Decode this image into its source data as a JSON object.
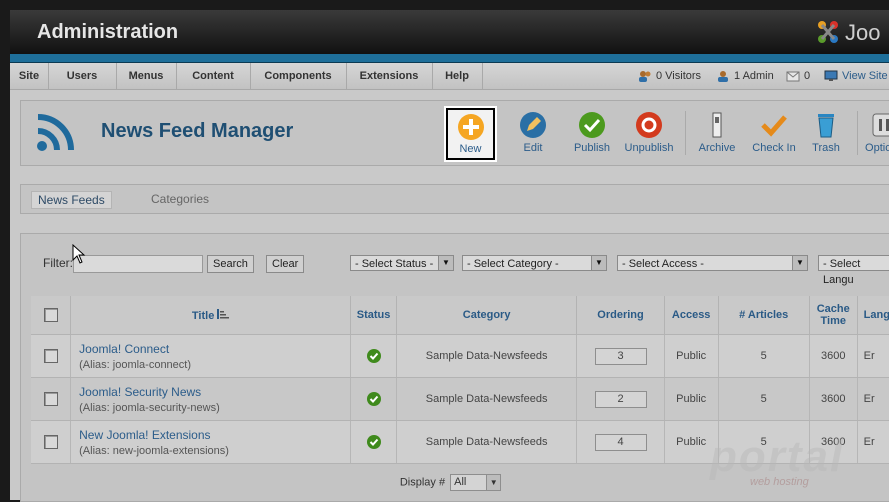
{
  "header": {
    "title": "Administration",
    "logo_text": "Joo"
  },
  "menu": {
    "items": [
      "Site",
      "Users",
      "Menus",
      "Content",
      "Components",
      "Extensions",
      "Help"
    ],
    "status": {
      "visitors": "0 Visitors",
      "admins": "1 Admin",
      "messages": "0",
      "view_site": "View Site"
    }
  },
  "page": {
    "title": "News Feed Manager",
    "icon": "rss-icon"
  },
  "toolbar": [
    {
      "label": "New",
      "icon": "plus-circle-icon",
      "highlighted": true
    },
    {
      "label": "Edit",
      "icon": "pencil-icon"
    },
    {
      "label": "Publish",
      "icon": "checkmark-icon"
    },
    {
      "label": "Unpublish",
      "icon": "stop-circle-icon"
    },
    {
      "label": "Archive",
      "icon": "archive-icon"
    },
    {
      "label": "Check In",
      "icon": "check-icon"
    },
    {
      "label": "Trash",
      "icon": "trash-icon"
    },
    {
      "label": "Options",
      "icon": "options-icon"
    }
  ],
  "subtabs": {
    "active": "News Feeds",
    "other": "Categories"
  },
  "filter": {
    "label": "Filter:",
    "value": "",
    "search_label": "Search",
    "clear_label": "Clear",
    "status_select": "- Select Status -",
    "category_select": "- Select Category -",
    "access_select": "- Select Access -",
    "language_select": "- Select Langu"
  },
  "table": {
    "columns": [
      "Title",
      "Status",
      "Category",
      "Ordering",
      "Access",
      "# Articles",
      "Cache Time",
      "Lang"
    ],
    "rows": [
      {
        "title": "Joomla! Connect",
        "alias": "(Alias: joomla-connect)",
        "category": "Sample Data-Newsfeeds",
        "ordering": "3",
        "access": "Public",
        "articles": "5",
        "cache": "3600",
        "lang": "Er"
      },
      {
        "title": "Joomla! Security News",
        "alias": "(Alias: joomla-security-news)",
        "category": "Sample Data-Newsfeeds",
        "ordering": "2",
        "access": "Public",
        "articles": "5",
        "cache": "3600",
        "lang": "Er"
      },
      {
        "title": "New Joomla! Extensions",
        "alias": "(Alias: new-joomla-extensions)",
        "category": "Sample Data-Newsfeeds",
        "ordering": "4",
        "access": "Public",
        "articles": "5",
        "cache": "3600",
        "lang": "Er"
      }
    ]
  },
  "footer": {
    "display_label": "Display #",
    "display_value": "All"
  },
  "watermark": {
    "text": "portal",
    "sub": "web hosting"
  },
  "colors": {
    "accent_blue": "#1e6f9a",
    "link": "#2b5c8a",
    "new_orange": "#f5a623",
    "publish_green": "#4c9a1e",
    "unpublish_red": "#d33a1d"
  }
}
